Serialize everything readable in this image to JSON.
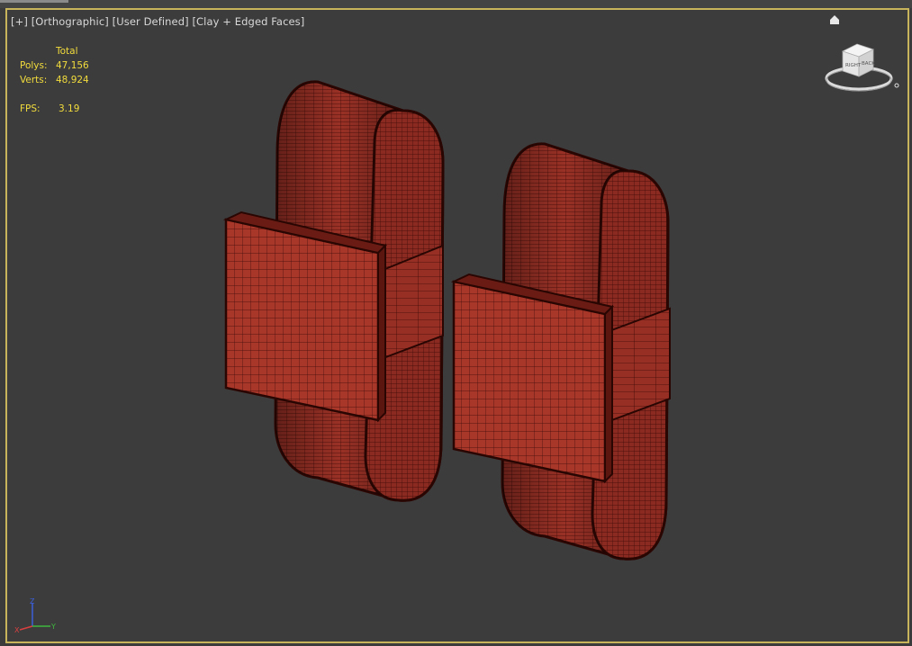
{
  "viewport": {
    "label_plus": "[+]",
    "label_view": "[Orthographic]",
    "label_mode": "[User Defined]",
    "label_shading": "[Clay + Edged Faces]"
  },
  "stats": {
    "header": "Total",
    "polys_label": "Polys:",
    "polys_value": "47,156",
    "verts_label": "Verts:",
    "verts_value": "48,924",
    "fps_label": "FPS:",
    "fps_value": "3.19"
  },
  "viewcube": {
    "face_left": "RIGHT",
    "face_right": "BACK"
  },
  "axis_gizmo": {
    "x": "X",
    "y": "Y",
    "z": "Z"
  },
  "colors": {
    "background": "#3c3c3c",
    "viewport_border": "#c8b45a",
    "stats_text": "#f2dc3c",
    "model_fill": "#9a3126",
    "wire": "#3a0a06"
  },
  "icons": [
    "home-icon",
    "viewcube-icon",
    "axis-gizmo-icon"
  ]
}
